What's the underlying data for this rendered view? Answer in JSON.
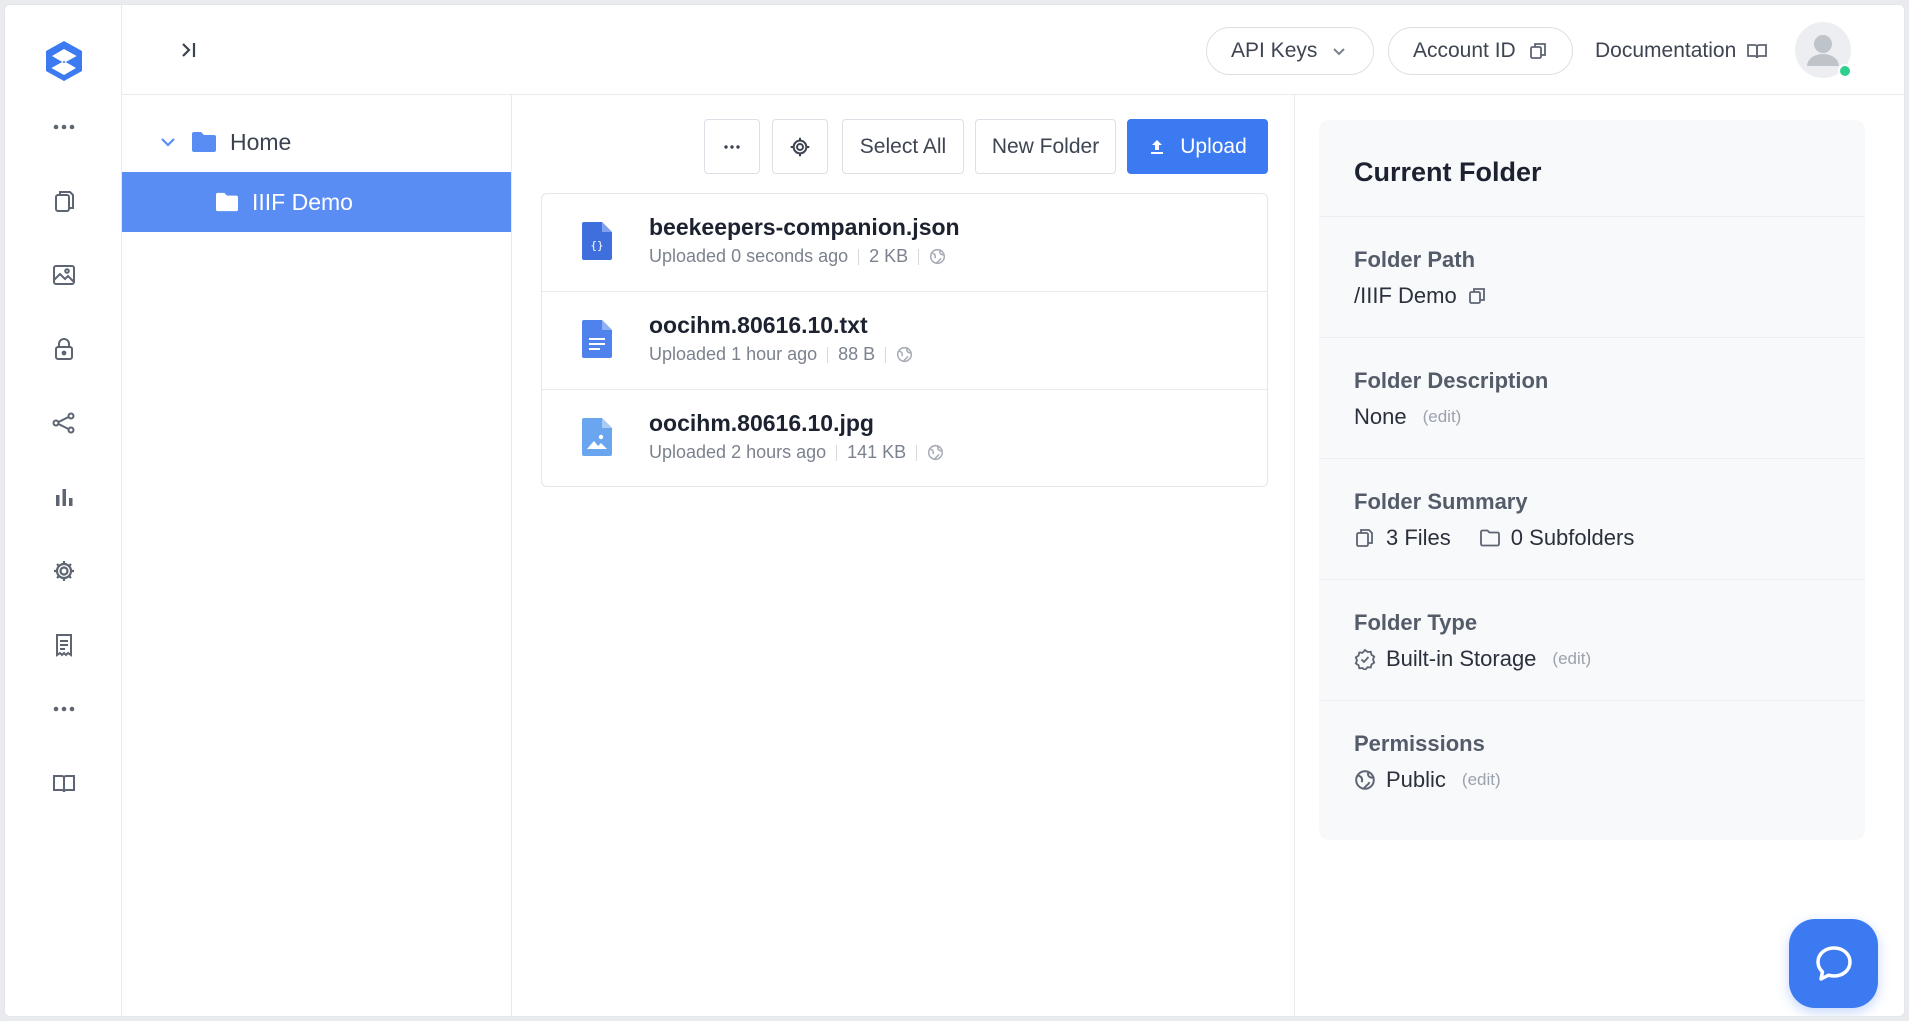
{
  "header": {
    "api_keys_label": "API Keys",
    "account_id_label": "Account ID",
    "documentation_label": "Documentation"
  },
  "rail": {
    "icons": [
      "logo-icon",
      "more-icon",
      "files-icon",
      "images-icon",
      "lock-icon",
      "share-icon",
      "chart-icon",
      "gear-icon",
      "receipt-icon",
      "more-icon",
      "book-icon"
    ]
  },
  "tree": {
    "items": [
      {
        "label": "Home"
      },
      {
        "label": "IIIF Demo"
      }
    ]
  },
  "toolbar": {
    "select_all_label": "Select All",
    "new_folder_label": "New Folder",
    "upload_label": "Upload"
  },
  "files": [
    {
      "name": "beekeepers-companion.json",
      "uploaded": "Uploaded 0 seconds ago",
      "size": "2 KB",
      "type": "json"
    },
    {
      "name": "oocihm.80616.10.txt",
      "uploaded": "Uploaded 1 hour ago",
      "size": "88 B",
      "type": "text"
    },
    {
      "name": "oocihm.80616.10.jpg",
      "uploaded": "Uploaded 2 hours ago",
      "size": "141 KB",
      "type": "image"
    }
  ],
  "panel": {
    "title": "Current Folder",
    "path_label": "Folder Path",
    "path_value": "/IIIF Demo",
    "description_label": "Folder Description",
    "description_value": "None",
    "summary_label": "Folder Summary",
    "summary_files": "3 Files",
    "summary_subfolders": "0 Subfolders",
    "type_label": "Folder Type",
    "type_value": "Built-in Storage",
    "permissions_label": "Permissions",
    "permissions_value": "Public",
    "edit_label": "(edit)"
  },
  "colors": {
    "accent": "#3b7af1",
    "selected_row": "#5a8df3",
    "online_dot": "#2fd08f"
  }
}
